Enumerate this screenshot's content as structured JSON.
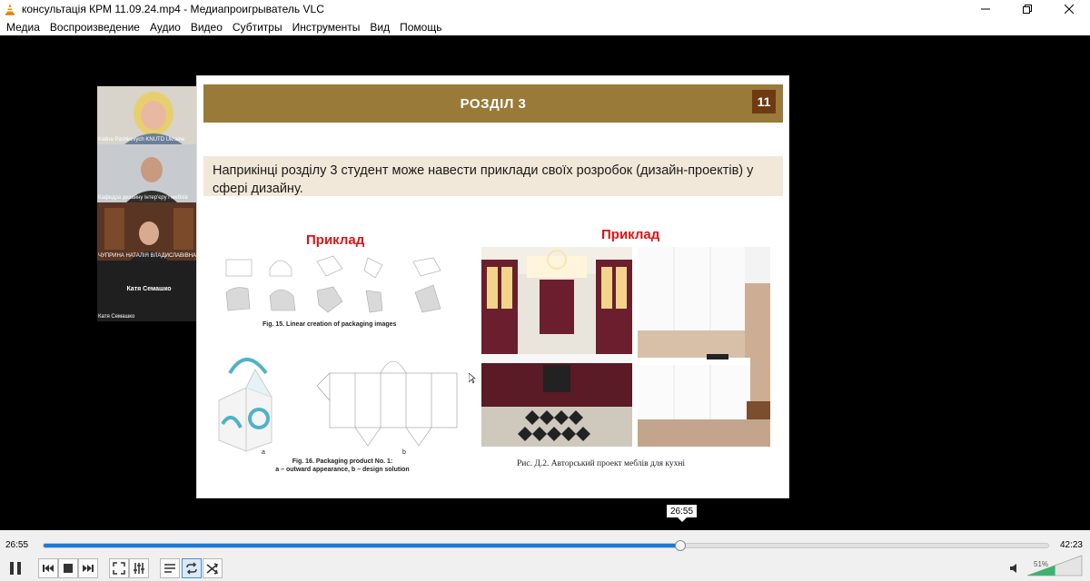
{
  "window": {
    "title": "консультація КРМ 11.09.24.mp4 - Медиапроигрыватель VLC",
    "controls": [
      "minimize-icon",
      "restore-icon",
      "close-icon"
    ]
  },
  "menu": [
    "Медиа",
    "Воспроизведение",
    "Аудио",
    "Видео",
    "Субтитры",
    "Инструменты",
    "Вид",
    "Помощь"
  ],
  "participants": [
    {
      "name": "Kalina Pashkevych KNUTD Ukraine"
    },
    {
      "name": "Кафедра дизайну інтер'єру і меблів"
    },
    {
      "name": "ЧУПРИНА НАТАЛІЯ ВЛАДИСЛАВІВНА"
    },
    {
      "name": "Катя Семашко",
      "center_name": "Катя Семашко"
    }
  ],
  "slide": {
    "header": "РОЗДІЛ 3",
    "number": "11",
    "text": "Наприкінці розділу 3 студент може навести приклади своїх розробок (дизайн-проектів) у сфері дизайну.",
    "example_left": "Приклад",
    "example_right": "Приклад",
    "fig15_caption": "Fig. 15. Linear creation of packaging images",
    "fig16_caption": "Fig. 16. Packaging product No. 1:",
    "fig16_sub": "a – outward appearance, b – design solution",
    "label_a": "a",
    "label_b": "b",
    "kitchen_caption": "Рис. Д.2. Авторський проект меблів для кухні"
  },
  "player": {
    "current_time": "26:55",
    "total_time": "42:23",
    "tooltip_time": "26:55",
    "progress": 0.634,
    "volume_label": "51%",
    "volume": 0.51,
    "accent": "#1a7ad9"
  }
}
